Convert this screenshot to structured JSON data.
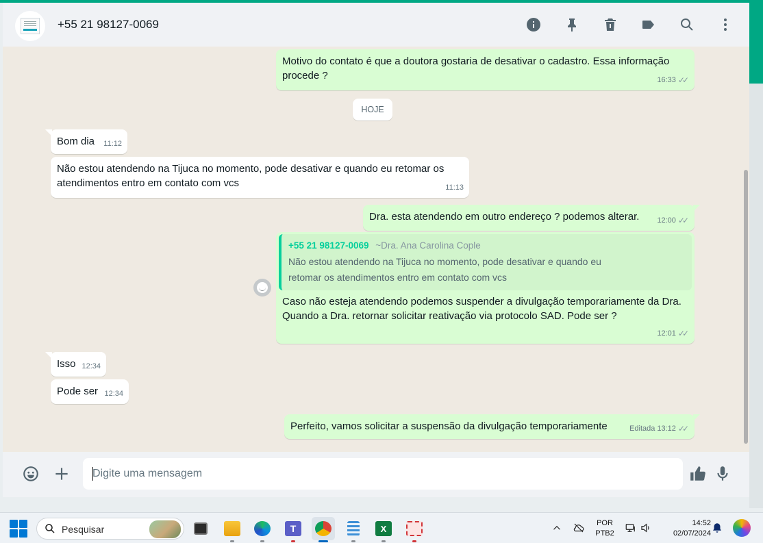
{
  "header": {
    "contact_name": "+55 21 98127-0069",
    "icons": [
      "info-icon",
      "pin-icon",
      "delete-icon",
      "label-icon",
      "search-icon",
      "menu-icon"
    ]
  },
  "messages": [
    {
      "id": "m1",
      "dir": "out",
      "text": "Motivo do contato é que a doutora gostaria de desativar o cadastro. Essa informação procede ?",
      "time": "16:33"
    },
    {
      "id": "m2",
      "dir": "in",
      "text": "Bom dia",
      "time": "11:12"
    },
    {
      "id": "m3",
      "dir": "in",
      "text": "Não estou atendendo na Tijuca no momento, pode desativar e quando eu retomar os atendimentos entro em contato com vcs",
      "time": "11:13"
    },
    {
      "id": "m4",
      "dir": "out",
      "text": "Dra. esta atendendo em outro endereço ? podemos alterar.",
      "time": "12:00"
    },
    {
      "id": "m5",
      "dir": "out",
      "quote_author": "+55 21 98127-0069",
      "quote_alias": "~Dra. Ana Carolina Cople",
      "quote_text": "Não estou atendendo na Tijuca no momento, pode desativar e quando eu retomar os atendimentos entro em contato com vcs",
      "text_line1": "Caso não esteja atendendo podemos suspender a divulgação temporariamente da Dra.",
      "text_line2": "Quando a Dra. retornar solicitar reativação via protocolo SAD. Pode ser ?",
      "time": "12:01"
    },
    {
      "id": "m6",
      "dir": "in",
      "text": "Isso",
      "time": "12:34"
    },
    {
      "id": "m7",
      "dir": "in",
      "text": "Pode ser",
      "time": "12:34"
    },
    {
      "id": "m8",
      "dir": "out",
      "text": "Perfeito, vamos solicitar a suspensão da divulgação temporariamente",
      "edited": "Editada",
      "time": "13:12"
    }
  ],
  "date_divider": "HOJE",
  "composer": {
    "placeholder": "Digite uma mensagem"
  },
  "taskbar": {
    "search_label": "Pesquisar",
    "lang_line1": "POR",
    "lang_line2": "PTB2",
    "clock_time": "14:52",
    "clock_date": "02/07/2024"
  }
}
